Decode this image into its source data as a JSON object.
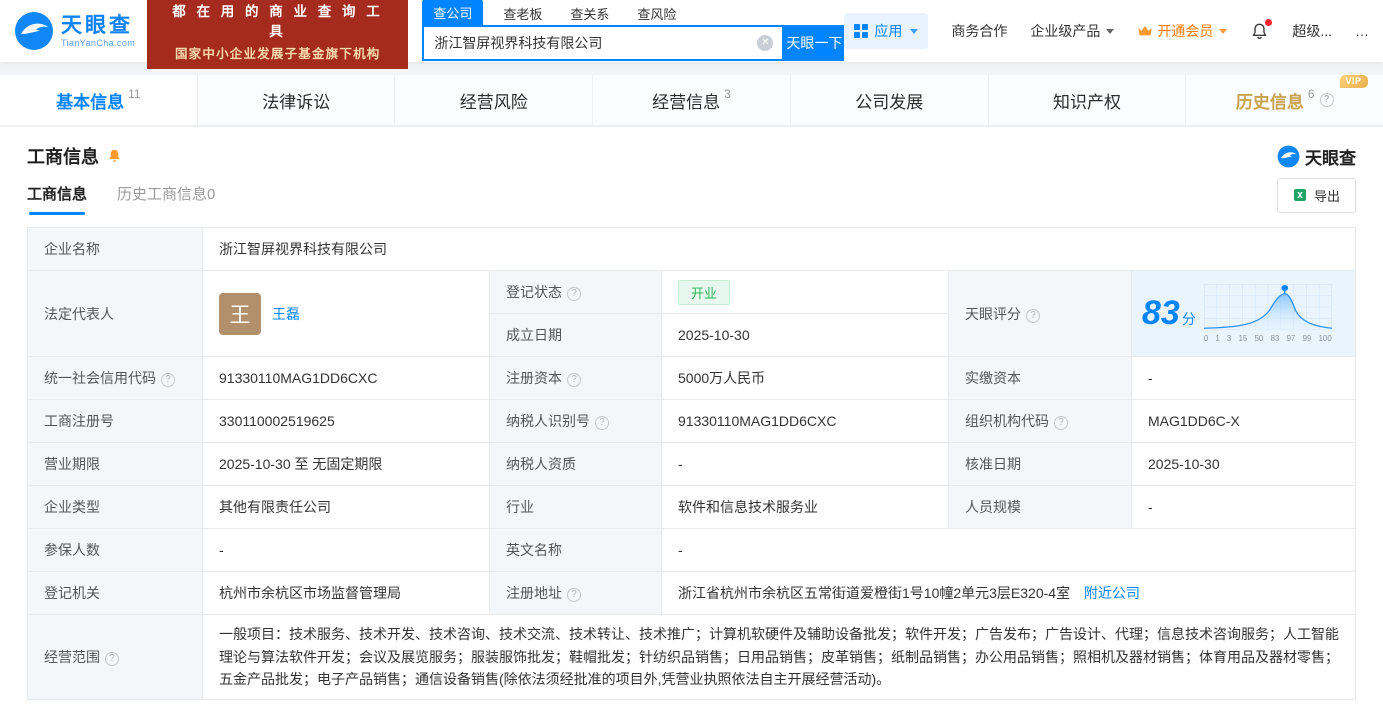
{
  "header": {
    "logo_title": "天眼查",
    "logo_subtitle": "TianYanCha.com",
    "promo_line1": "都 在 用 的 商 业 查 询 工 具",
    "promo_line2": "国家中小企业发展子基金旗下机构",
    "search_tabs": [
      {
        "label": "查公司",
        "active": true
      },
      {
        "label": "查老板",
        "active": false
      },
      {
        "label": "查关系",
        "active": false
      },
      {
        "label": "查风险",
        "active": false
      }
    ],
    "search_value": "浙江智屏视界科技有限公司",
    "search_button": "天眼一下",
    "apps_label": "应用",
    "biz_coop_label": "商务合作",
    "enterprise_label": "企业级产品",
    "vip_label": "开通会员",
    "super_label": "超级...",
    "more_label": "…"
  },
  "main_tabs": [
    {
      "label": "基本信息",
      "badge": "11",
      "active": true
    },
    {
      "label": "法律诉讼",
      "badge": "",
      "active": false
    },
    {
      "label": "经营风险",
      "badge": "",
      "active": false
    },
    {
      "label": "经营信息",
      "badge": "3",
      "active": false
    },
    {
      "label": "公司发展",
      "badge": "",
      "active": false
    },
    {
      "label": "知识产权",
      "badge": "",
      "active": false
    },
    {
      "label": "历史信息",
      "badge": "6",
      "active": false,
      "vip": "VIP"
    }
  ],
  "section": {
    "title": "工商信息",
    "brand": "天眼查",
    "subtab_active": "工商信息",
    "subtab_history": "历史工商信息0",
    "export_label": "导出"
  },
  "info": {
    "company_name_label": "企业名称",
    "company_name": "浙江智屏视界科技有限公司",
    "legal_rep_label": "法定代表人",
    "legal_rep_avatar": "王",
    "legal_rep_name": "王磊",
    "reg_status_label": "登记状态",
    "reg_status_value": "开业",
    "score_label": "天眼评分",
    "score_value": "83",
    "score_suffix": "分",
    "score_axis": [
      "0",
      "1",
      "3",
      "15",
      "50",
      "83",
      "97",
      "99",
      "100"
    ],
    "established_label": "成立日期",
    "established_value": "2025-10-30",
    "credit_code_label": "统一社会信用代码",
    "credit_code_value": "91330110MAG1DD6CXC",
    "reg_capital_label": "注册资本",
    "reg_capital_value": "5000万人民币",
    "paid_capital_label": "实缴资本",
    "paid_capital_value": "-",
    "reg_number_label": "工商注册号",
    "reg_number_value": "330110002519625",
    "taxpayer_id_label": "纳税人识别号",
    "taxpayer_id_value": "91330110MAG1DD6CXC",
    "org_code_label": "组织机构代码",
    "org_code_value": "MAG1DD6C-X",
    "business_term_label": "营业期限",
    "business_term_value": "2025-10-30 至 无固定期限",
    "taxpayer_quality_label": "纳税人资质",
    "taxpayer_quality_value": "-",
    "approval_date_label": "核准日期",
    "approval_date_value": "2025-10-30",
    "company_type_label": "企业类型",
    "company_type_value": "其他有限责任公司",
    "industry_label": "行业",
    "industry_value": "软件和信息技术服务业",
    "staff_size_label": "人员规模",
    "staff_size_value": "-",
    "insured_label": "参保人数",
    "insured_value": "-",
    "english_name_label": "英文名称",
    "english_name_value": "-",
    "reg_authority_label": "登记机关",
    "reg_authority_value": "杭州市余杭区市场监督管理局",
    "address_label": "注册地址",
    "address_value": "浙江省杭州市余杭区五常街道爱橙街1号10幢2单元3层E320-4室",
    "nearby_link": "附近公司",
    "business_scope_label": "经营范围",
    "business_scope_value": "一般项目：技术服务、技术开发、技术咨询、技术交流、技术转让、技术推广；计算机软硬件及辅助设备批发；软件开发；广告发布；广告设计、代理；信息技术咨询服务；人工智能理论与算法软件开发；会议及展览服务；服装服饰批发；鞋帽批发；针纺织品销售；日用品销售；皮革销售；纸制品销售；办公用品销售；照相机及器材销售；体育用品及器材零售；五金产品批发；电子产品销售；通信设备销售(除依法须经批准的项目外,凭营业执照依法自主开展经营活动)。"
  }
}
